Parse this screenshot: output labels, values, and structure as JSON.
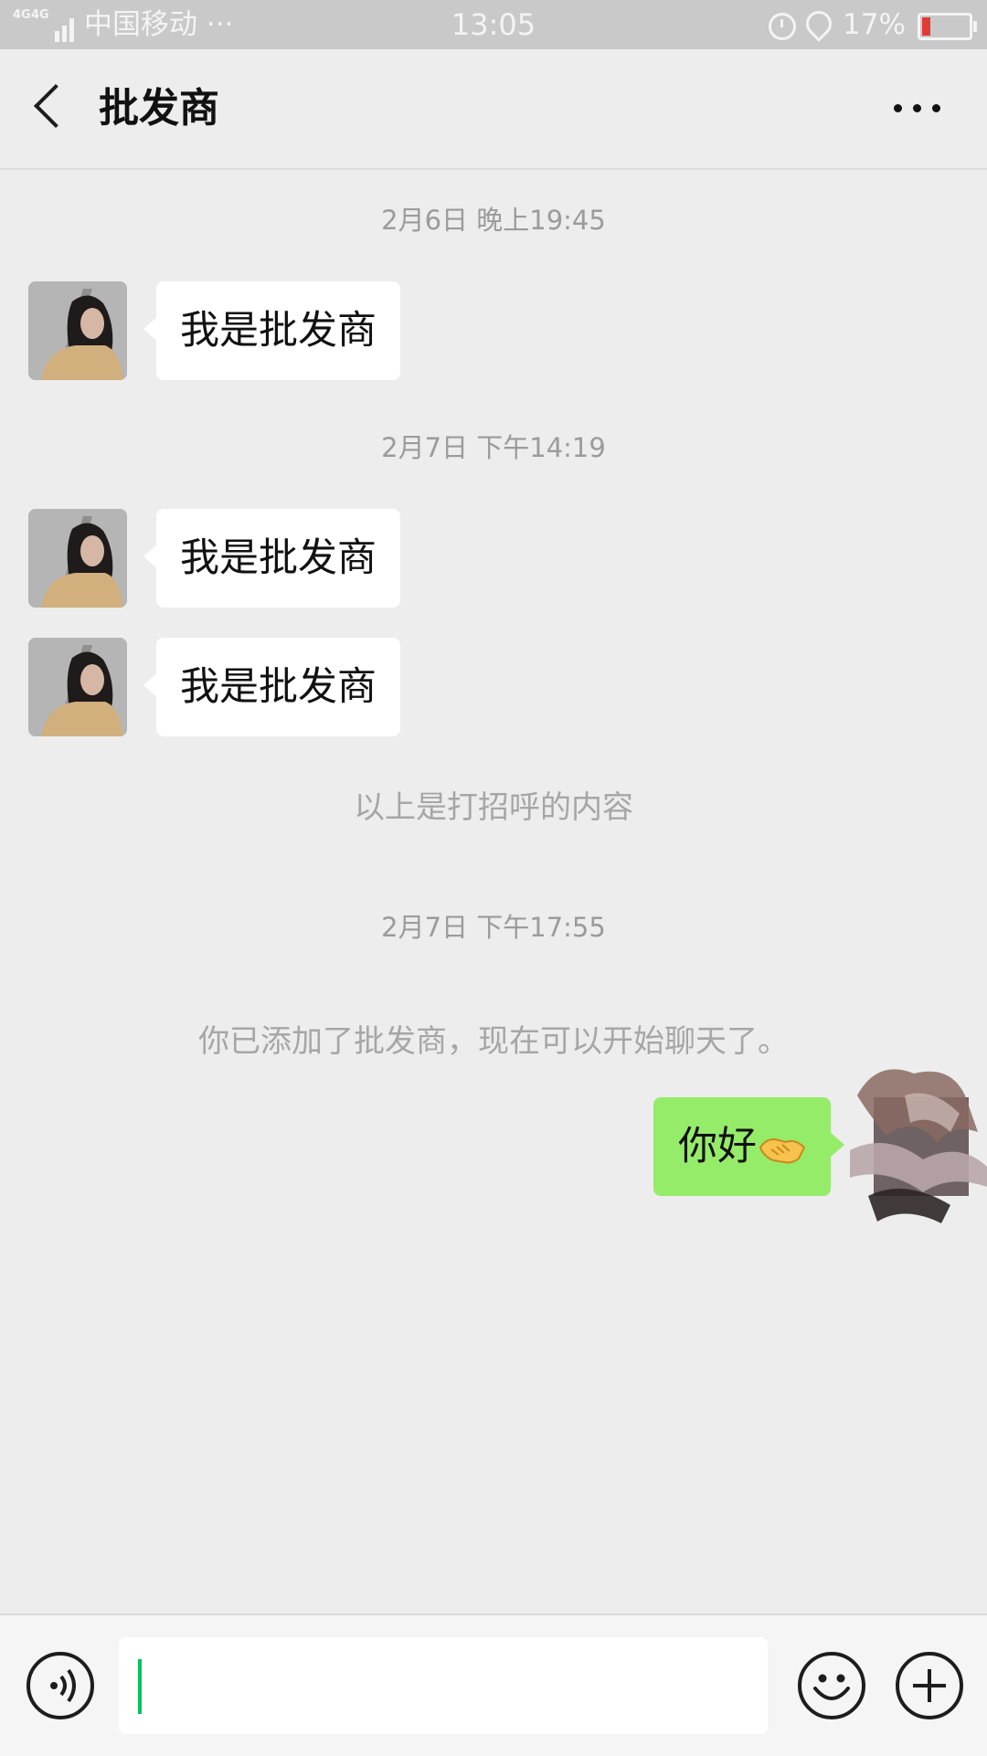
{
  "status_bar": {
    "network": "4G 4G",
    "carrier": "中国移动 ···",
    "time": "13:05",
    "battery": "17%",
    "battery_level": 0.17,
    "icons": [
      "signal-icon",
      "alarm-icon",
      "location-icon",
      "battery-icon"
    ]
  },
  "header": {
    "title": "批发商",
    "back_icon": "chevron-left-icon",
    "more_icon": "more-dots-icon"
  },
  "chat": {
    "timestamps": [
      "2月6日 晚上19:45",
      "2月7日 下午14:19",
      "2月7日 下午17:55"
    ],
    "messages": [
      {
        "sender": "批发商",
        "text": "我是批发商"
      },
      {
        "sender": "批发商",
        "text": "我是批发商"
      },
      {
        "sender": "批发商",
        "text": "我是批发商"
      }
    ],
    "greeting_note": "以上是打招呼的内容",
    "system_message": "你已添加了批发商，现在可以开始聊天了。",
    "outgoing": {
      "text": "你好",
      "emoji": "handshake-emoji"
    }
  },
  "input_bar": {
    "voice_icon": "voice-icon",
    "emoji_icon": "smiley-icon",
    "plus_icon": "plus-circle-icon",
    "input_value": ""
  },
  "colors": {
    "background": "#ededed",
    "outgoing_bubble": "#95ec69",
    "incoming_bubble": "#ffffff",
    "cursor": "#07c160",
    "battery_low": "#e23b36"
  }
}
